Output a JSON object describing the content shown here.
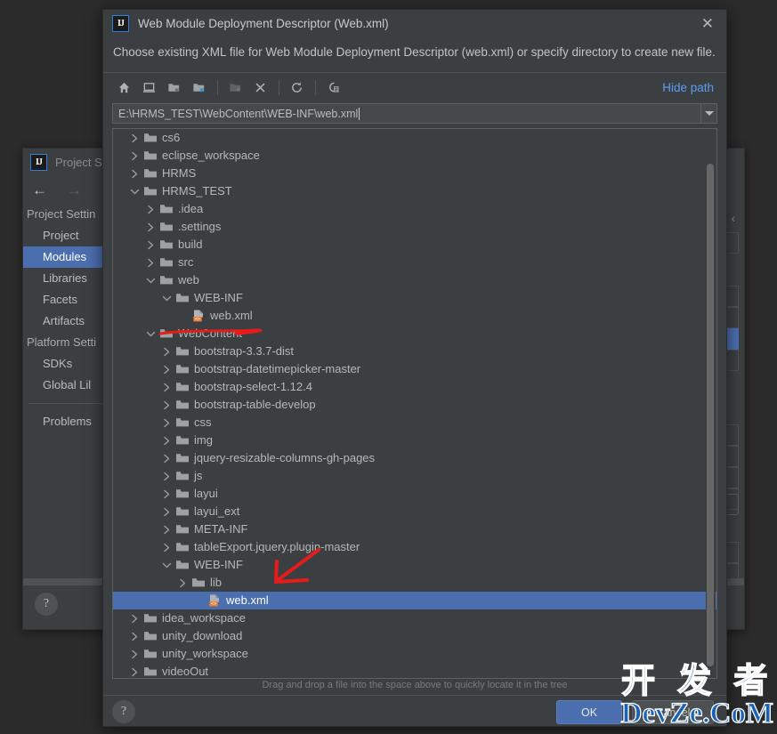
{
  "background_dialog": {
    "title": "Project Str",
    "logo": "intellij-idea-logo-icon",
    "nav": {
      "back": "back-arrow-icon",
      "forward": "forward-arrow-icon"
    },
    "sidebar": [
      {
        "label": "Project Settin",
        "type": "group"
      },
      {
        "label": "Project",
        "type": "child"
      },
      {
        "label": "Modules",
        "type": "child",
        "selected": true
      },
      {
        "label": "Libraries",
        "type": "child"
      },
      {
        "label": "Facets",
        "type": "child"
      },
      {
        "label": "Artifacts",
        "type": "child"
      },
      {
        "label": "Platform Setti",
        "type": "group"
      },
      {
        "label": "SDKs",
        "type": "child"
      },
      {
        "label": "Global Lil",
        "type": "child"
      },
      {
        "label": "Problems",
        "type": "child",
        "after_separator": true
      }
    ],
    "help_label": "?",
    "ext_button": "t"
  },
  "dialog": {
    "logo": "intellij-idea-logo-icon",
    "title": "Web Module Deployment Descriptor (Web.xml)",
    "close_label": "✕",
    "description": "Choose existing XML file for Web Module Deployment Descriptor (web.xml) or specify directory to create new file.",
    "toolbar": {
      "buttons": [
        {
          "name": "home-icon",
          "tooltip": "Home",
          "enabled": true
        },
        {
          "name": "desktop-icon",
          "tooltip": "Desktop",
          "enabled": true
        },
        {
          "name": "project-folder-icon",
          "tooltip": "Project Directory",
          "enabled": true
        },
        {
          "name": "module-folder-icon",
          "tooltip": "Module Directory",
          "enabled": true
        },
        {
          "name": "new-folder-icon",
          "tooltip": "New Folder",
          "enabled": false
        },
        {
          "name": "delete-icon",
          "tooltip": "Delete",
          "enabled": true
        },
        {
          "name": "refresh-icon",
          "tooltip": "Refresh",
          "enabled": true
        },
        {
          "name": "show-hidden-files-icon",
          "tooltip": "Show Hidden Files",
          "enabled": true
        }
      ],
      "hide_path_label": "Hide path"
    },
    "path": {
      "value": "E:\\HRMS_TEST\\WebContent\\WEB-INF\\web.xml",
      "placeholder": "",
      "dropdown_icon": "chevron-down-icon"
    },
    "hint": "Drag and drop a file into the space above to quickly locate it in the tree",
    "help_label": "?",
    "ok_label": "OK",
    "cancel_label": "Cancel"
  },
  "tree": [
    {
      "label": "cs6",
      "depth": 0,
      "state": "collapsed",
      "icon": "folder-icon"
    },
    {
      "label": "eclipse_workspace",
      "depth": 0,
      "state": "collapsed",
      "icon": "folder-icon"
    },
    {
      "label": "HRMS",
      "depth": 0,
      "state": "collapsed",
      "icon": "folder-icon"
    },
    {
      "label": "HRMS_TEST",
      "depth": 0,
      "state": "expanded",
      "icon": "folder-icon"
    },
    {
      "label": ".idea",
      "depth": 1,
      "state": "collapsed",
      "icon": "folder-icon"
    },
    {
      "label": ".settings",
      "depth": 1,
      "state": "collapsed",
      "icon": "folder-icon"
    },
    {
      "label": "build",
      "depth": 1,
      "state": "collapsed",
      "icon": "folder-icon"
    },
    {
      "label": "src",
      "depth": 1,
      "state": "collapsed",
      "icon": "folder-icon"
    },
    {
      "label": "web",
      "depth": 1,
      "state": "expanded",
      "icon": "folder-icon"
    },
    {
      "label": "WEB-INF",
      "depth": 2,
      "state": "expanded",
      "icon": "folder-icon"
    },
    {
      "label": "web.xml",
      "depth": 3,
      "state": "leaf",
      "icon": "xml-file-icon"
    },
    {
      "label": "WebContent",
      "depth": 1,
      "state": "expanded",
      "icon": "folder-icon",
      "annotated": "underline"
    },
    {
      "label": "bootstrap-3.3.7-dist",
      "depth": 2,
      "state": "collapsed",
      "icon": "folder-icon"
    },
    {
      "label": "bootstrap-datetimepicker-master",
      "depth": 2,
      "state": "collapsed",
      "icon": "folder-icon"
    },
    {
      "label": "bootstrap-select-1.12.4",
      "depth": 2,
      "state": "collapsed",
      "icon": "folder-icon"
    },
    {
      "label": "bootstrap-table-develop",
      "depth": 2,
      "state": "collapsed",
      "icon": "folder-icon"
    },
    {
      "label": "css",
      "depth": 2,
      "state": "collapsed",
      "icon": "folder-icon"
    },
    {
      "label": "img",
      "depth": 2,
      "state": "collapsed",
      "icon": "folder-icon"
    },
    {
      "label": "jquery-resizable-columns-gh-pages",
      "depth": 2,
      "state": "collapsed",
      "icon": "folder-icon"
    },
    {
      "label": "js",
      "depth": 2,
      "state": "collapsed",
      "icon": "folder-icon"
    },
    {
      "label": "layui",
      "depth": 2,
      "state": "collapsed",
      "icon": "folder-icon"
    },
    {
      "label": "layui_ext",
      "depth": 2,
      "state": "collapsed",
      "icon": "folder-icon"
    },
    {
      "label": "META-INF",
      "depth": 2,
      "state": "collapsed",
      "icon": "folder-icon"
    },
    {
      "label": "tableExport.jquery.plugin-master",
      "depth": 2,
      "state": "collapsed",
      "icon": "folder-icon"
    },
    {
      "label": "WEB-INF",
      "depth": 2,
      "state": "expanded",
      "icon": "folder-icon"
    },
    {
      "label": "lib",
      "depth": 3,
      "state": "collapsed",
      "icon": "folder-icon"
    },
    {
      "label": "web.xml",
      "depth": 4,
      "state": "leaf",
      "icon": "xml-file-icon",
      "selected": true
    },
    {
      "label": "idea_workspace",
      "depth": 0,
      "state": "collapsed",
      "icon": "folder-icon"
    },
    {
      "label": "unity_download",
      "depth": 0,
      "state": "collapsed",
      "icon": "folder-icon"
    },
    {
      "label": "unity_workspace",
      "depth": 0,
      "state": "collapsed",
      "icon": "folder-icon"
    },
    {
      "label": "videoOut",
      "depth": 0,
      "state": "collapsed",
      "icon": "folder-icon"
    }
  ],
  "annotations": {
    "underline_color": "#e81b1b",
    "arrow_color": "#e81b1b"
  },
  "watermark": {
    "line1": "开 发 者",
    "line2": "DevZe.CoM",
    "color": "#1a62b8"
  }
}
